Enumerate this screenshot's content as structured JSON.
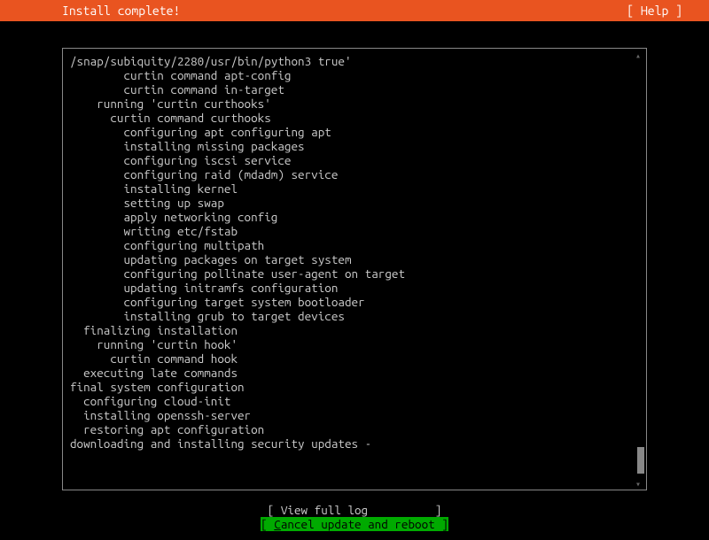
{
  "header": {
    "title": "Install complete!",
    "help": "[ Help ]"
  },
  "log_lines": [
    {
      "indent": 0,
      "text": "/snap/subiquity/2280/usr/bin/python3 true'"
    },
    {
      "indent": 8,
      "text": "curtin command apt-config"
    },
    {
      "indent": 8,
      "text": "curtin command in-target"
    },
    {
      "indent": 4,
      "text": "running 'curtin curthooks'"
    },
    {
      "indent": 6,
      "text": "curtin command curthooks"
    },
    {
      "indent": 8,
      "text": "configuring apt configuring apt"
    },
    {
      "indent": 8,
      "text": "installing missing packages"
    },
    {
      "indent": 8,
      "text": "configuring iscsi service"
    },
    {
      "indent": 8,
      "text": "configuring raid (mdadm) service"
    },
    {
      "indent": 8,
      "text": "installing kernel"
    },
    {
      "indent": 8,
      "text": "setting up swap"
    },
    {
      "indent": 8,
      "text": "apply networking config"
    },
    {
      "indent": 8,
      "text": "writing etc/fstab"
    },
    {
      "indent": 8,
      "text": "configuring multipath"
    },
    {
      "indent": 8,
      "text": "updating packages on target system"
    },
    {
      "indent": 8,
      "text": "configuring pollinate user-agent on target"
    },
    {
      "indent": 8,
      "text": "updating initramfs configuration"
    },
    {
      "indent": 8,
      "text": "configuring target system bootloader"
    },
    {
      "indent": 8,
      "text": "installing grub to target devices"
    },
    {
      "indent": 2,
      "text": "finalizing installation"
    },
    {
      "indent": 4,
      "text": "running 'curtin hook'"
    },
    {
      "indent": 6,
      "text": "curtin command hook"
    },
    {
      "indent": 2,
      "text": "executing late commands"
    },
    {
      "indent": 0,
      "text": "final system configuration"
    },
    {
      "indent": 2,
      "text": "configuring cloud-init"
    },
    {
      "indent": 2,
      "text": "installing openssh-server"
    },
    {
      "indent": 2,
      "text": "restoring apt configuration"
    },
    {
      "indent": 0,
      "text": "downloading and installing security updates -"
    }
  ],
  "buttons": {
    "view_full_log": "[ View full log          ]",
    "cancel_reboot": {
      "prefix": "[ ",
      "hotkey": "C",
      "rest": "ancel update and reboot ]"
    }
  }
}
